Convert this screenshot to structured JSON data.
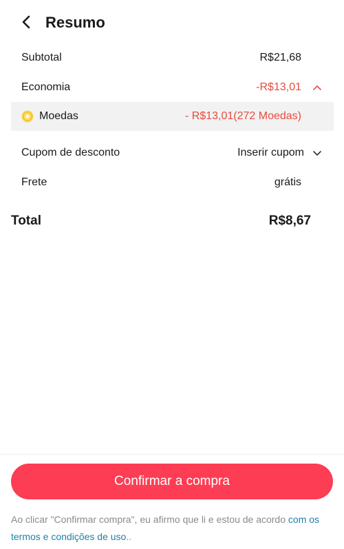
{
  "header": {
    "title": "Resumo",
    "back_icon": "back-arrow-icon"
  },
  "summary": {
    "subtotal": {
      "label": "Subtotal",
      "value": "R$21,68"
    },
    "economia": {
      "label": "Economia",
      "value": "-R$13,01",
      "chevron": "chevron-up-icon"
    },
    "moedas": {
      "label": "Moedas",
      "value": "- R$13,01(272 Moedas)",
      "icon": "coin-icon"
    },
    "cupom": {
      "label": "Cupom de desconto",
      "value": "Inserir cupom",
      "chevron": "chevron-down-icon"
    },
    "frete": {
      "label": "Frete",
      "value": "grátis"
    }
  },
  "total": {
    "label": "Total",
    "value": "R$8,67"
  },
  "confirm_button": "Confirmar a compra",
  "terms": {
    "text": "Ao clicar \"Confirmar compra\", eu afirmo que li e estou de acordo",
    "link": "com os termos e condições de uso",
    "suffix": ".."
  },
  "colors": {
    "accent": "#fc3d54",
    "discount": "#e84b3c",
    "link": "#1f7fa6"
  }
}
